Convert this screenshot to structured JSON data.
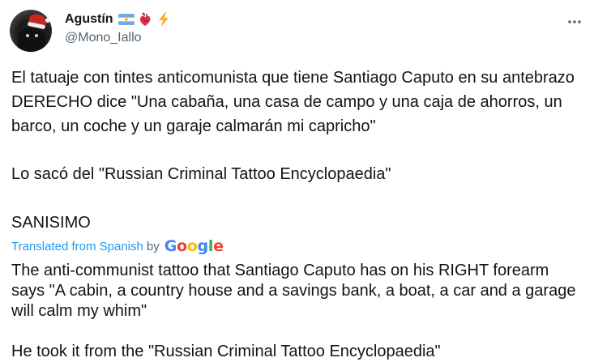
{
  "author": {
    "display_name": "Agustín",
    "handle": "@Mono_Iallo",
    "badges": [
      "argentina-flag-icon",
      "anatomical-heart-icon",
      "lightning-bolt-icon"
    ]
  },
  "tweet": {
    "paragraph_1": "El tatuaje con tintes anticomunista que tiene Santiago Caputo en su antebrazo DERECHO dice \"Una cabaña, una casa de campo y una caja de ahorros, un barco, un coche y un garaje calmarán mi capricho\"",
    "paragraph_2": "Lo sacó del \"Russian Criminal Tattoo Encyclopaedia\"",
    "paragraph_3": "SANISIMO"
  },
  "translation": {
    "label": "Translated from Spanish",
    "by": "by",
    "provider_letters": [
      "G",
      "o",
      "o",
      "g",
      "l",
      "e"
    ],
    "paragraph_1": "The anti-communist tattoo that Santiago Caputo has on his RIGHT forearm says \"A cabin, a country house and a savings bank, a boat, a car and a garage will calm my whim\"",
    "paragraph_2": "He took it from the \"Russian Criminal Tattoo Encyclopaedia\""
  },
  "colors": {
    "text": "#0f1419",
    "secondary": "#536471",
    "link": "#1d9bf0",
    "google": [
      "#4285F4",
      "#EA4335",
      "#FBBC05",
      "#4285F4",
      "#34A853",
      "#EA4335"
    ]
  }
}
